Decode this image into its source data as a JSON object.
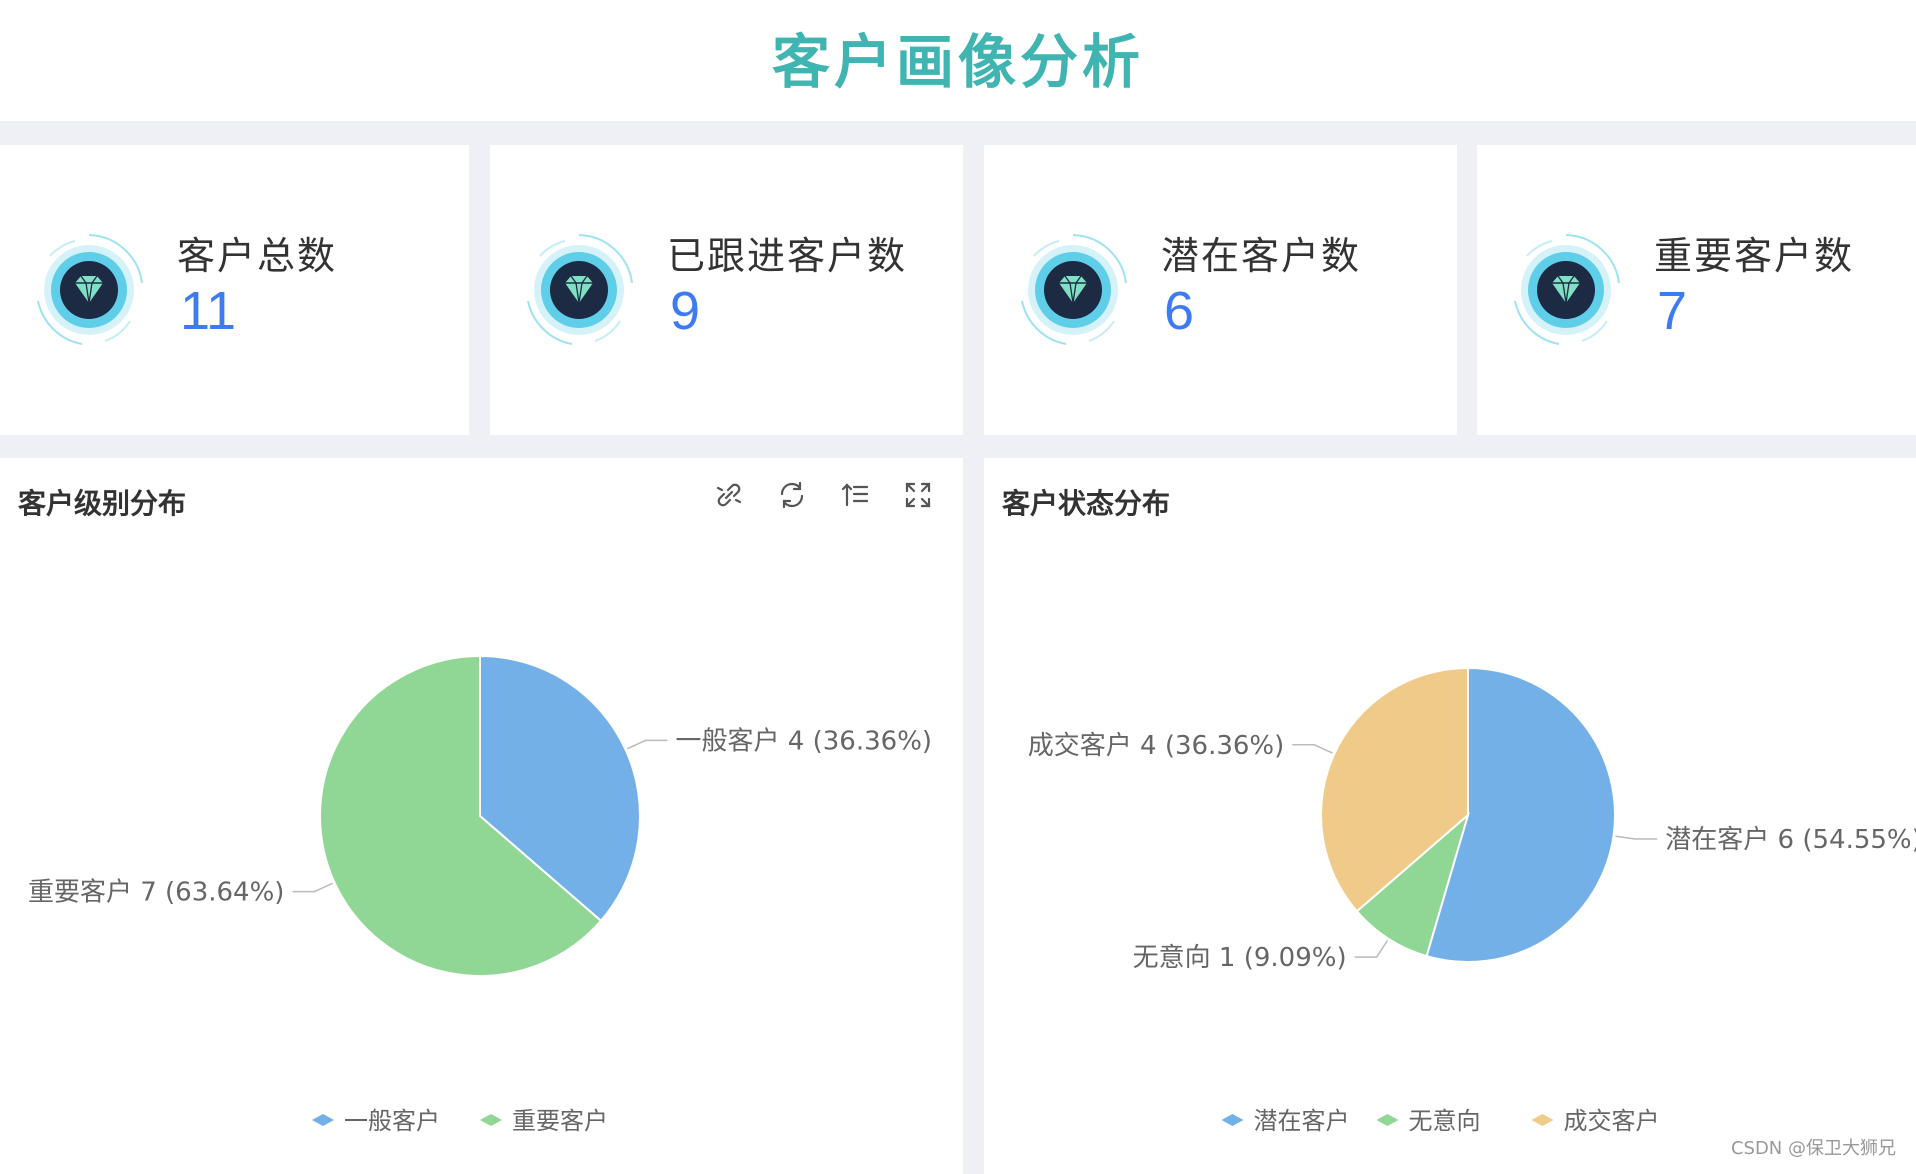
{
  "header": {
    "title": "客户画像分析"
  },
  "stats": [
    {
      "label": "客户总数",
      "value": "11"
    },
    {
      "label": "已跟进客户数",
      "value": "9"
    },
    {
      "label": "潜在客户数",
      "value": "6"
    },
    {
      "label": "重要客户数",
      "value": "7"
    }
  ],
  "colors": {
    "title": "#3fb4b0",
    "number": "#3d7bf4",
    "blue": "#74b0e8",
    "green": "#90d694",
    "orange": "#f0ca88"
  },
  "panels": {
    "level": {
      "title": "客户级别分布"
    },
    "status": {
      "title": "客户状态分布"
    }
  },
  "toolbox": [
    "link-icon",
    "refresh-icon",
    "sort-icon",
    "fullscreen-icon"
  ],
  "chart_data": [
    {
      "type": "pie",
      "title": "客户级别分布",
      "slices": [
        {
          "name": "一般客户",
          "value": 4,
          "percent": "36.36%",
          "label": "一般客户  4 (36.36%)",
          "color": "#74b0e8"
        },
        {
          "name": "重要客户",
          "value": 7,
          "percent": "63.64%",
          "label": "重要客户  7 (63.64%)",
          "color": "#90d694"
        }
      ],
      "legend": [
        "一般客户",
        "重要客户"
      ],
      "legend_position": "bottom"
    },
    {
      "type": "pie",
      "title": "客户状态分布",
      "slices": [
        {
          "name": "潜在客户",
          "value": 6,
          "percent": "54.55%",
          "label": "潜在客户  6 (54.55%)",
          "color": "#74b0e8"
        },
        {
          "name": "无意向",
          "value": 1,
          "percent": "9.09%",
          "label": "无意向  1 (9.09%)",
          "color": "#90d694"
        },
        {
          "name": "成交客户",
          "value": 4,
          "percent": "36.36%",
          "label": "成交客户  4 (36.36%)",
          "color": "#f0ca88"
        }
      ],
      "legend": [
        "潜在客户",
        "无意向",
        "成交客户"
      ],
      "legend_position": "bottom"
    }
  ],
  "watermark": "CSDN @保卫大狮兄"
}
